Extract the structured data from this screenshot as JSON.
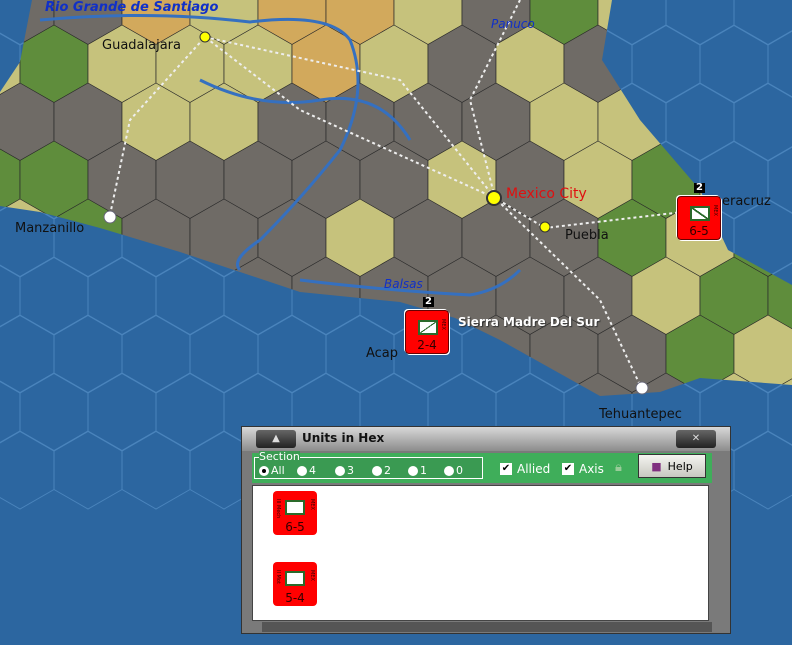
{
  "map": {
    "labels": {
      "rio_grande": "Rio Grande de Santiago",
      "guadalajara": "Guadalajara",
      "panuco": "Panuco",
      "manzanillo": "Manzanillo",
      "mexico_city": "Mexico City",
      "puebla": "Puebla",
      "veracruz": "eracruz",
      "balsas": "Balsas",
      "sierra": "Sierra Madre Del Sur",
      "acapulco": "Acap",
      "tehuantepec": "Tehuantepec"
    },
    "units": [
      {
        "location": "Veracruz",
        "stack_count": "2",
        "strength": "6-5",
        "nation": "MEX",
        "type": "infantry"
      },
      {
        "location": "Acapulco",
        "stack_count": "2",
        "strength": "2-4",
        "nation": "MEX",
        "type": "cavalry"
      }
    ]
  },
  "window": {
    "title": "Units in Hex",
    "section_label": "Section",
    "sections": [
      "All",
      "4",
      "3",
      "2",
      "1",
      "0"
    ],
    "selected_section": "All",
    "allied_label": "Allied",
    "allied_checked": true,
    "axis_label": "Axis",
    "axis_checked": true,
    "help_label": "Help",
    "units": [
      {
        "strength": "6-5",
        "nation": "MEX",
        "designation": "III Mech"
      },
      {
        "strength": "5-4",
        "nation": "MEX",
        "designation": "II Mot"
      }
    ]
  },
  "colors": {
    "sea": "#2c66a0",
    "unit": "#ff0000",
    "panel": "#3fae5a"
  }
}
